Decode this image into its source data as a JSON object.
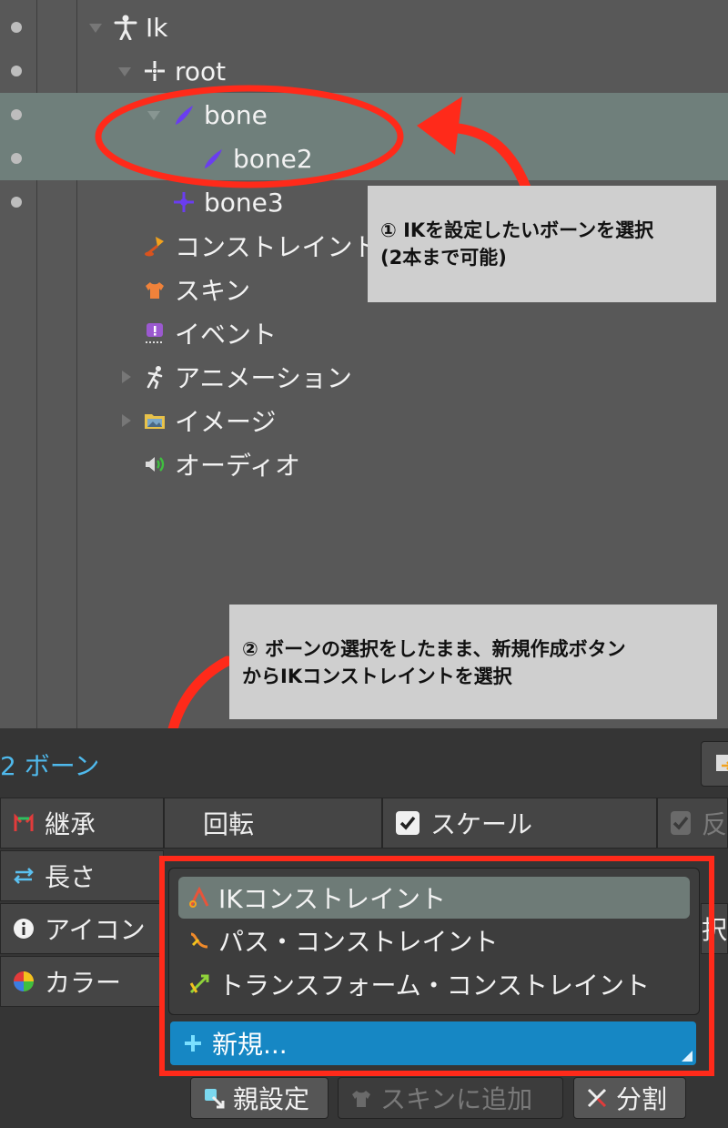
{
  "tree": {
    "items": [
      {
        "label": "Ik",
        "icon": "skeleton-icon"
      },
      {
        "label": "root",
        "icon": "root-bone-icon"
      },
      {
        "label": "bone",
        "icon": "bone-icon"
      },
      {
        "label": "bone2",
        "icon": "bone-icon"
      },
      {
        "label": "bone3",
        "icon": "bone-cross-icon"
      },
      {
        "label": "コンストレイント",
        "icon": "constraint-pin-icon"
      },
      {
        "label": "スキン",
        "icon": "skin-shirt-icon"
      },
      {
        "label": "イベント",
        "icon": "event-icon"
      },
      {
        "label": "アニメーション",
        "icon": "animation-runner-icon"
      },
      {
        "label": "イメージ",
        "icon": "image-folder-icon"
      },
      {
        "label": "オーディオ",
        "icon": "audio-speaker-icon"
      }
    ]
  },
  "callouts": {
    "step1": "① IKを設定したいボーンを選択",
    "step1_sub": "(2本まで可能)",
    "step2": "② ボーンの選択をしたまま、新規作成ボタン",
    "step2_sub": "からIKコンストレイントを選択"
  },
  "panel": {
    "title": "2 ボーン",
    "rows": [
      {
        "label": "継承",
        "icon": "inherit-icon"
      },
      {
        "label": "長さ",
        "icon": "length-arrows-icon"
      },
      {
        "label": "アイコン",
        "icon": "info-icon"
      },
      {
        "label": "カラー",
        "icon": "color-wheel-icon"
      }
    ],
    "rotate_label": "回転",
    "scale_label": "スケール",
    "reflect_label": "反",
    "cut_text": "択"
  },
  "menu": {
    "items": [
      {
        "label": "IKコンストレイント",
        "icon": "ik-constraint-icon"
      },
      {
        "label": "パス・コンストレイント",
        "icon": "path-constraint-icon"
      },
      {
        "label": "トランスフォーム・コンストレイント",
        "icon": "transform-constraint-icon"
      }
    ],
    "new_label": "新規..."
  },
  "buttons": {
    "parent": "親設定",
    "add_skin": "スキンに追加",
    "split": "分割"
  },
  "colors": {
    "selection": "#6f7f7b",
    "accent_blue": "#1687c4",
    "annotation_red": "#ff2a1a",
    "title_blue": "#4fb9ec"
  }
}
